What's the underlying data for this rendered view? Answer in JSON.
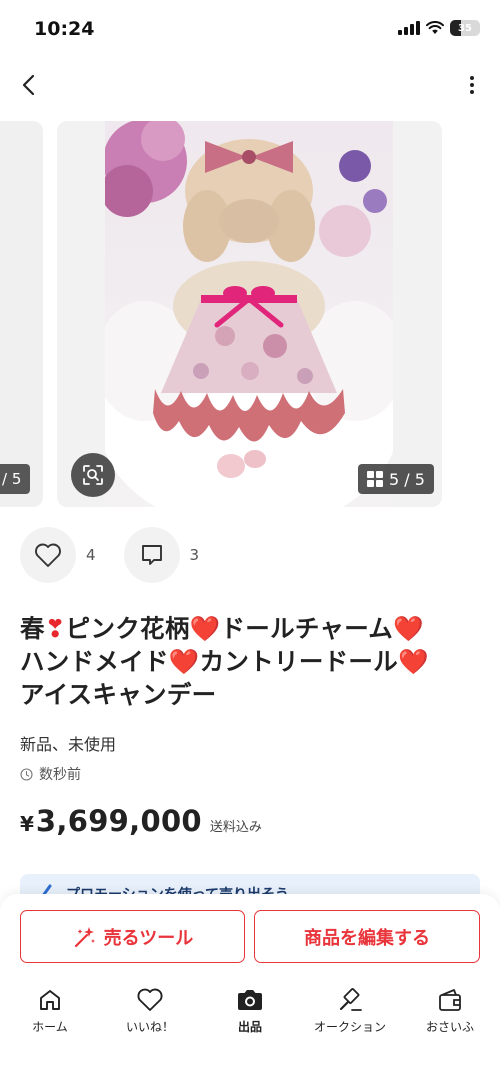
{
  "status_bar": {
    "time": "10:24",
    "battery": "35"
  },
  "gallery": {
    "prev_counter": "/ 5",
    "counter": "5 / 5",
    "current_image": 5,
    "total_images": 5
  },
  "social": {
    "likes": "4",
    "comments": "3"
  },
  "item": {
    "title_parts": [
      "春",
      "❣",
      "ピンク花柄",
      "❤️",
      "ドールチャーム",
      "❤️",
      "ハンドメイド",
      "❤️",
      "カントリードール",
      "❤️",
      "アイスキャンデー"
    ],
    "condition": "新品、未使用",
    "posted": "数秒前",
    "currency": "¥",
    "price": "3,699,000",
    "shipping": "送料込み"
  },
  "promo": {
    "text": "プロモーションを使って売り出そう"
  },
  "actions": {
    "sell_tools": "売るツール",
    "edit_item": "商品を編集する"
  },
  "tabs": [
    {
      "label": "ホーム",
      "icon": "home-icon"
    },
    {
      "label": "いいね！",
      "icon": "heart-icon"
    },
    {
      "label": "出品",
      "icon": "camera-icon"
    },
    {
      "label": "オークション",
      "icon": "gavel-icon"
    },
    {
      "label": "おさいふ",
      "icon": "wallet-icon"
    }
  ],
  "colors": {
    "accent": "#e8343a",
    "heart": "#e8272d",
    "promo_bg": "#e8f0fb"
  }
}
